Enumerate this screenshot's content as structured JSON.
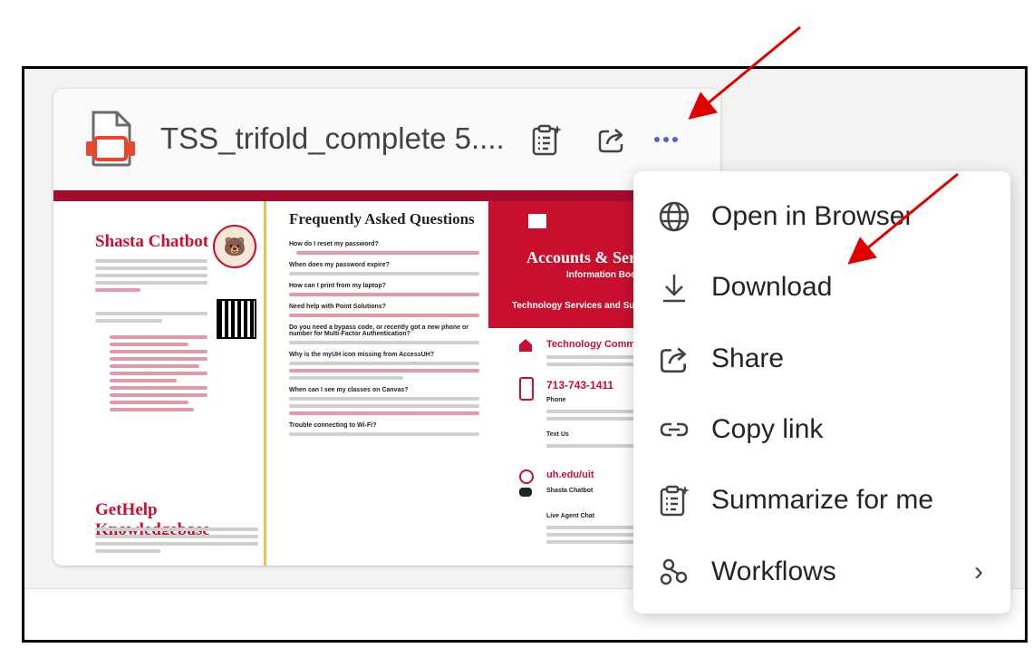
{
  "file_card": {
    "file_name": "TSS_trifold_complete 5....",
    "icons": [
      "file-presentation-icon",
      "summarize-icon",
      "share-icon",
      "more-options-icon"
    ]
  },
  "preview": {
    "left": {
      "title1": "Shasta Chatbot",
      "title2": "GetHelp Knowledgebase"
    },
    "middle": {
      "title": "Frequently Asked Questions",
      "questions": [
        "How do I reset my password?",
        "When does my password expire?",
        "How can I print from my laptop?",
        "Need help with Point Solutions?",
        "Do you need a bypass code, or recently got a new phone or number for Multi-Factor Authentication?",
        "Why is the myUH icon missing from AccessUH?",
        "When can I see my classes on Canvas?",
        "Trouble connecting to Wi-Fi?"
      ]
    },
    "right": {
      "banner_title": "Accounts & Services",
      "banner_subtitle": "Information Booklet",
      "banner_footer": "Technology Services and Support",
      "contact_title": "Technology Commons",
      "phone": "713-743-1411",
      "phone_label": "Phone",
      "text_label": "Text Us",
      "web": "uh.edu/uit",
      "chatbot_label": "Shasta Chatbot",
      "live_chat": "Live Agent Chat"
    }
  },
  "menu": {
    "items": [
      {
        "label": "Open in Browser",
        "icon": "globe-icon"
      },
      {
        "label": "Download",
        "icon": "download-icon"
      },
      {
        "label": "Share",
        "icon": "share-icon"
      },
      {
        "label": "Copy link",
        "icon": "link-icon"
      },
      {
        "label": "Summarize for me",
        "icon": "summarize-icon"
      },
      {
        "label": "Workflows",
        "icon": "workflows-icon",
        "has_submenu": true
      }
    ]
  },
  "colors": {
    "accent": "#5b5fc7",
    "annotation_arrow": "#e00000",
    "uh_red": "#c8102e",
    "file_icon": "#e8472d"
  }
}
